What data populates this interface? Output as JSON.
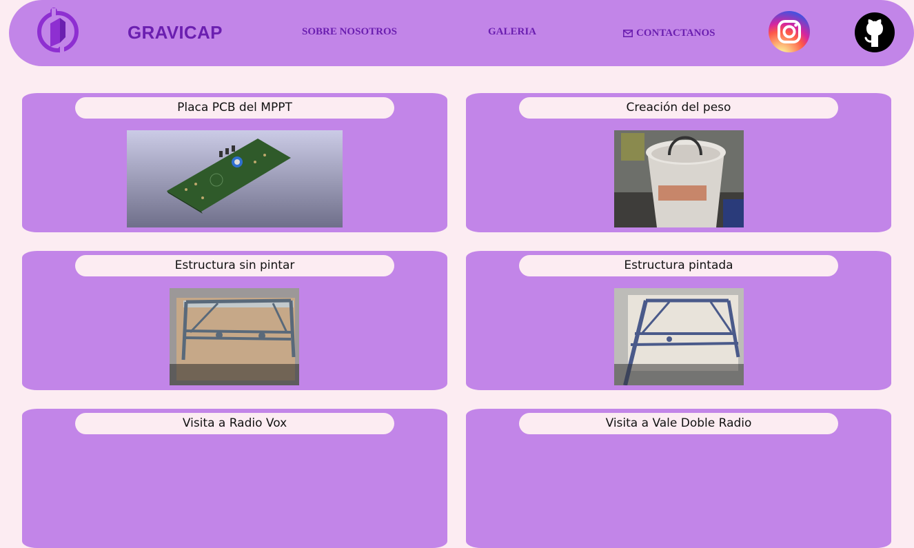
{
  "header": {
    "brand": "GRAVICAP",
    "nav": {
      "about": "SOBRE NOSOTROS",
      "gallery": "GALERIA",
      "contact": "CONTACTANOS"
    },
    "icons": [
      "logo-icon",
      "mail-icon",
      "instagram-icon",
      "github-icon"
    ]
  },
  "gallery": {
    "items": [
      {
        "title": "Placa PCB del MPPT"
      },
      {
        "title": "Creación del peso"
      },
      {
        "title": "Estructura sin pintar"
      },
      {
        "title": "Estructura pintada"
      },
      {
        "title": "Visita a Radio Vox"
      },
      {
        "title": "Visita a Vale Doble Radio"
      }
    ]
  },
  "colors": {
    "background": "#fcecf2",
    "panel": "#c285e8",
    "accent_text": "#6b1fb0"
  }
}
